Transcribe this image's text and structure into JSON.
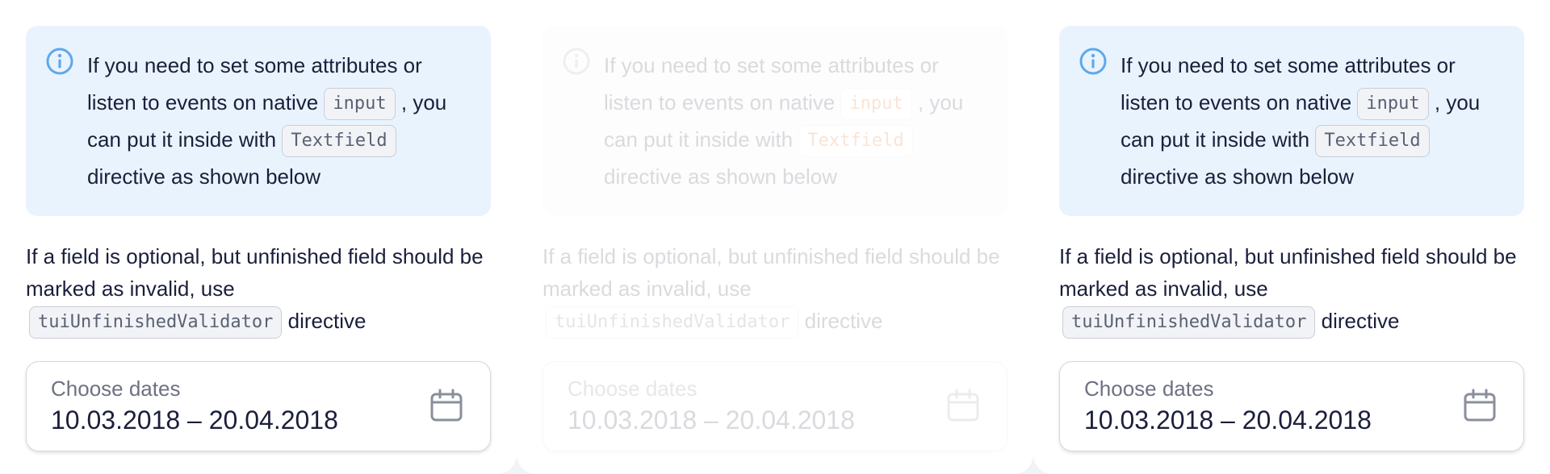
{
  "panels": [
    {
      "notice": {
        "text_1": "If you need to set some attributes or listen to events on native",
        "code_1": "input",
        "text_2": ", you can put it inside with",
        "code_2": "Textfield",
        "text_3": "directive as shown below"
      },
      "para": {
        "text_1": "If a field is optional, but unfinished field should be marked as invalid, use",
        "code": "tuiUnfinishedValidator",
        "text_2": "directive"
      },
      "field": {
        "label": "Choose dates",
        "value": "10.03.2018 – 20.04.2018"
      }
    },
    {
      "notice": {
        "text_1": "If you need to set some attributes or listen to events on native",
        "code_1": "input",
        "text_2": ", you can put it inside with",
        "code_2": "Textfield",
        "text_3": "directive as shown below"
      },
      "para": {
        "text_1": "If a field is optional, but unfinished field should be marked as invalid, use",
        "code": "tuiUnfinishedValidator",
        "text_2": "directive"
      },
      "field": {
        "label": "Choose dates",
        "value": "10.03.2018 – 20.04.2018"
      }
    },
    {
      "notice": {
        "text_1": "If you need to set some attributes or listen to events on native",
        "code_1": "input",
        "text_2": ", you can put it inside with",
        "code_2": "Textfield",
        "text_3": "directive as shown below"
      },
      "para": {
        "text_1": "If a field is optional, but unfinished field should be marked as invalid, use",
        "code": "tuiUnfinishedValidator",
        "text_2": "directive"
      },
      "field": {
        "label": "Choose dates",
        "value": "10.03.2018 – 20.04.2018"
      }
    }
  ],
  "colors": {
    "notice_bg": "#e9f3fd",
    "info_icon": "#5fa8ea",
    "code_accent_dim": "#e55c00",
    "text": "#1b1f3b",
    "muted": "#6c7281"
  },
  "icons": {
    "notice": "info-icon",
    "field": "calendar-icon"
  }
}
